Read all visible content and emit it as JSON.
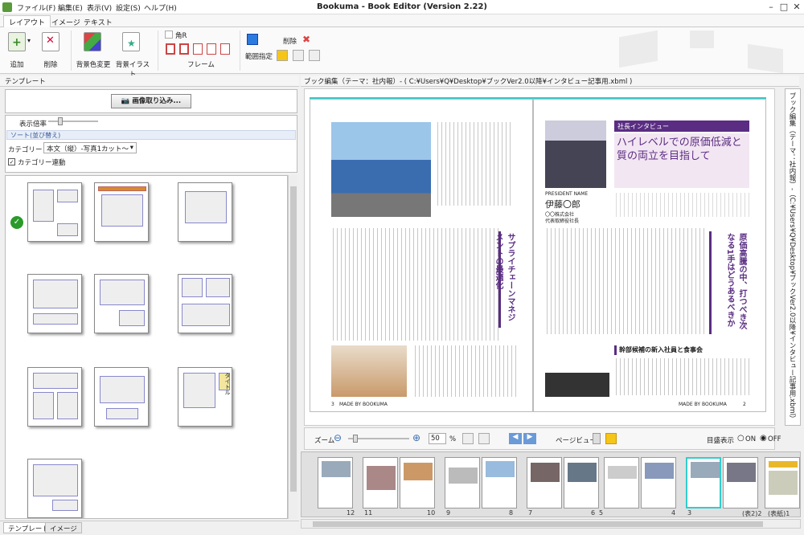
{
  "window": {
    "title": "Bookuma - Book Editor (Version 2.22)"
  },
  "menu": [
    "ファイル(F)",
    "編集(E)",
    "表示(V)",
    "設定(S)",
    "ヘルプ(H)"
  ],
  "ribbon_tabs": [
    "レイアウト",
    "イメージ",
    "テキスト"
  ],
  "ribbon": {
    "add": "追加",
    "delete": "削除",
    "bg_color": "背景色変更",
    "bg_illust": "背景イラスト",
    "corner_r": "角R",
    "frame": "フレーム",
    "range": "範囲指定",
    "delete2": "削除"
  },
  "left": {
    "header": "テンプレート",
    "import_btn": "画像取り込み...",
    "zoom_label": "表示倍率",
    "sort_label": "ソート(並び替え)",
    "category_label": "カテゴリー",
    "category_value": "本文（縦）-写真1カット～",
    "category_link": "カテゴリー連動",
    "title_label": "タイトル"
  },
  "bottom_tabs": [
    "テンプレート",
    "イメージ"
  ],
  "right": {
    "header": "ブック編集（テーマ：社内報）- ( C:¥Users¥Q¥Desktop¥ブックVer2.0以降¥インタビュー記事用.xbml )",
    "vtab": "ブック編集（テーマ：社内報）-（C:¥Users¥Q¥Desktop¥ブックVer2.0以降¥インタビュー記事用.xbml）"
  },
  "page_left": {
    "headline_v": "サプライチェーンマネジメントの最適化",
    "footer": "MADE BY BOOKUMA",
    "page_no": "3"
  },
  "page_right": {
    "kicker": "社長インタビュー",
    "headline": "ハイレベルでの原価低減と質の両立を目指して",
    "role": "PRESIDENT NAME",
    "name": "伊藤〇郎",
    "company": "〇〇株式会社",
    "title": "代表取締役社長",
    "headline_v": "原価高騰の中、打つべき次なる1手はどうあるべきか",
    "subhead": "幹部候補の新入社員と食事会",
    "footer": "MADE BY BOOKUMA",
    "page_no": "2"
  },
  "zoom": {
    "label": "ズーム",
    "value": "50",
    "unit": "%",
    "page_view": "ページビュー",
    "mihiraki": "目盛表示",
    "on": "ON",
    "off": "OFF",
    "off_selected": true
  },
  "film_numbers": [
    "12",
    "11",
    "10",
    "9",
    "8",
    "7",
    "6",
    "5",
    "4",
    "3",
    "(表2)2",
    "(表紙)1"
  ],
  "colors": {
    "accent": "#5a2d82",
    "brand_green": "#5a9a3a"
  }
}
